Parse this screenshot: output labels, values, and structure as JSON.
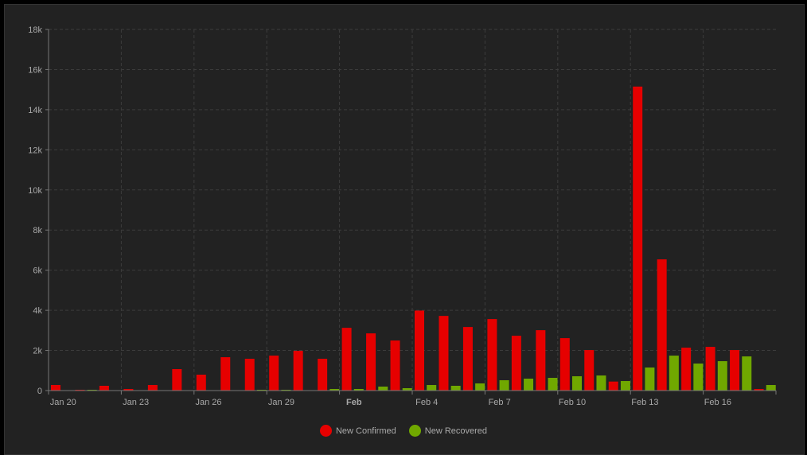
{
  "chart_data": {
    "type": "bar",
    "title": "",
    "xlabel": "",
    "ylabel": "",
    "ylim": [
      0,
      18000
    ],
    "yticks": [
      "0",
      "2k",
      "4k",
      "6k",
      "8k",
      "10k",
      "12k",
      "14k",
      "16k",
      "18k"
    ],
    "categories": [
      "Jan 20",
      "Jan 21",
      "Jan 22",
      "Jan 23",
      "Jan 24",
      "Jan 25",
      "Jan 26",
      "Jan 27",
      "Jan 28",
      "Jan 29",
      "Jan 30",
      "Jan 31",
      "Feb 1",
      "Feb 2",
      "Feb 3",
      "Feb 4",
      "Feb 5",
      "Feb 6",
      "Feb 7",
      "Feb 8",
      "Feb 9",
      "Feb 10",
      "Feb 11",
      "Feb 12",
      "Feb 13",
      "Feb 14",
      "Feb 15",
      "Feb 16",
      "Feb 17",
      "Feb 18"
    ],
    "xtick_labels": [
      {
        "index": 0,
        "label": "Jan 20"
      },
      {
        "index": 3,
        "label": "Jan 23"
      },
      {
        "index": 6,
        "label": "Jan 26"
      },
      {
        "index": 9,
        "label": "Jan 29"
      },
      {
        "index": 12,
        "label": "Feb",
        "bold": true
      },
      {
        "index": 15,
        "label": "Feb 4"
      },
      {
        "index": 18,
        "label": "Feb 7"
      },
      {
        "index": 21,
        "label": "Feb 10"
      },
      {
        "index": 24,
        "label": "Feb 13"
      },
      {
        "index": 27,
        "label": "Feb 16"
      }
    ],
    "series": [
      {
        "name": "New Confirmed",
        "color": "#e60000",
        "values": [
          277,
          40,
          238,
          79,
          277,
          1070,
          792,
          1663,
          1584,
          1742,
          1980,
          1584,
          3128,
          2851,
          2495,
          3986,
          3722,
          3168,
          3564,
          2732,
          3010,
          2614,
          2020,
          449,
          15152,
          6540,
          2138,
          2178,
          2020,
          79
        ]
      },
      {
        "name": "New Recovered",
        "color": "#70a800",
        "values": [
          0,
          40,
          5,
          5,
          0,
          5,
          5,
          5,
          40,
          40,
          5,
          79,
          79,
          198,
          119,
          277,
          238,
          356,
          515,
          594,
          634,
          713,
          752,
          475,
          1148,
          1742,
          1346,
          1465,
          1703,
          277
        ]
      }
    ],
    "grid": true,
    "legend": "bottom-center"
  }
}
